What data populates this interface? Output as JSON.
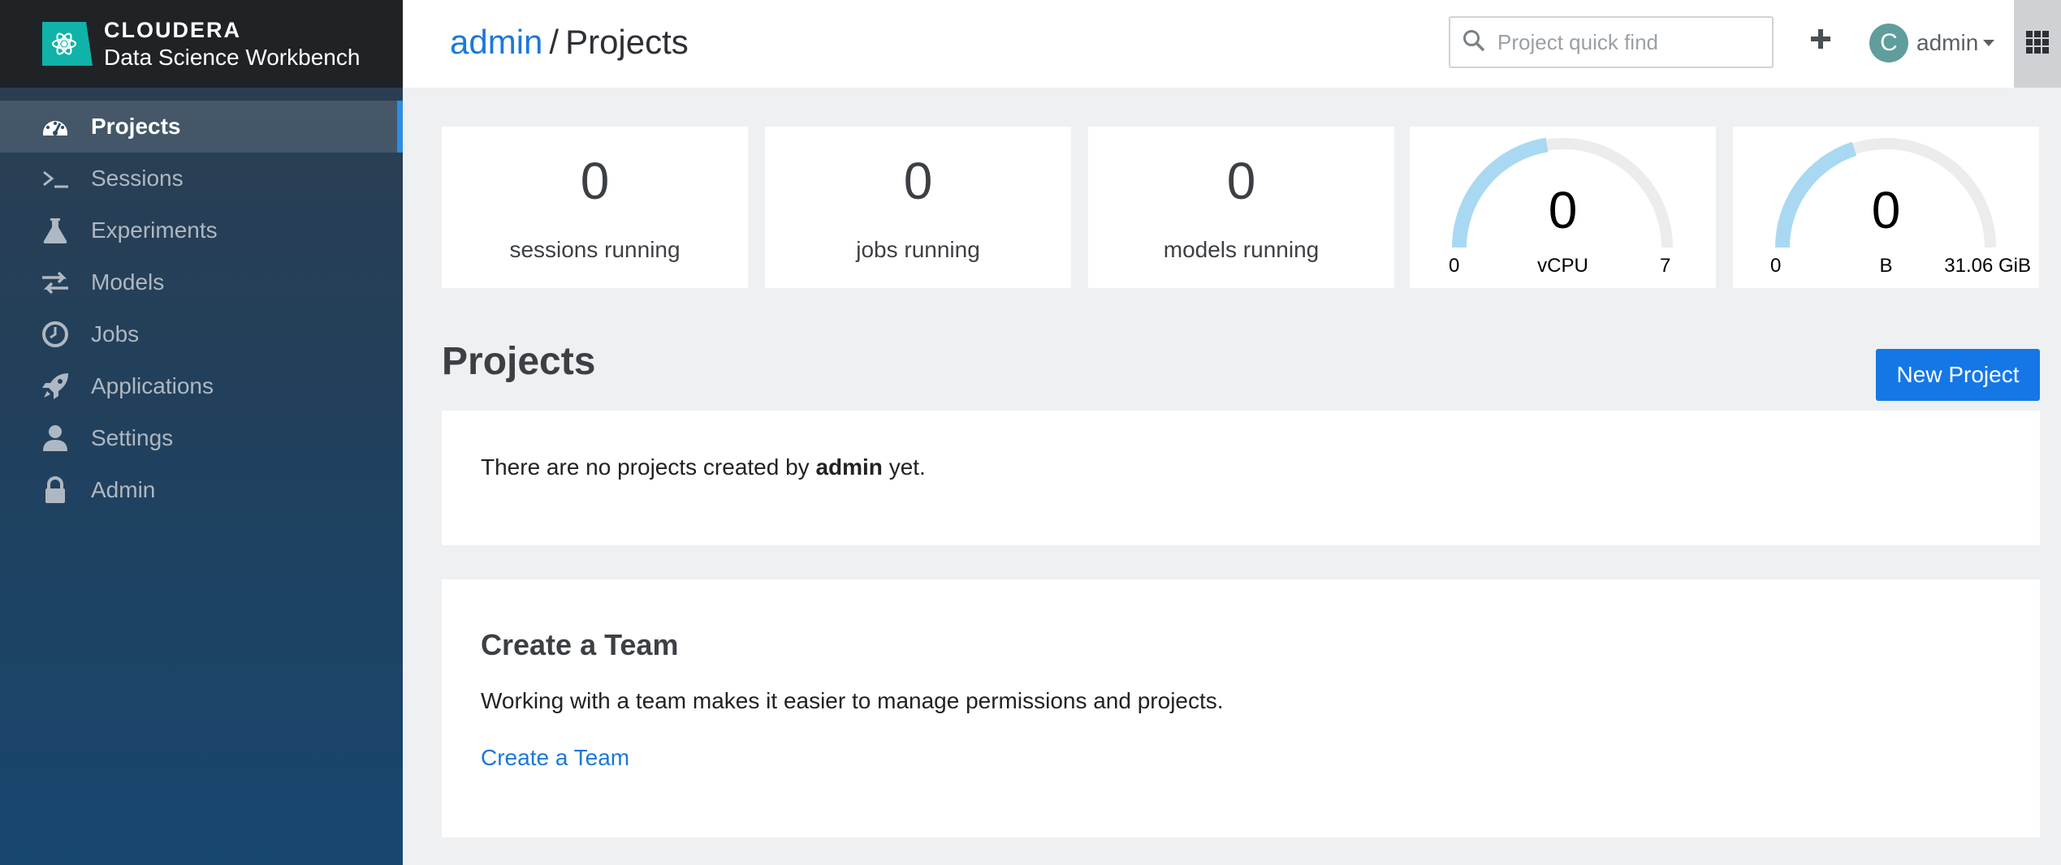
{
  "brand": {
    "name_line1": "CLOUDERA",
    "name_line2": "Data Science Workbench"
  },
  "sidebar": {
    "items": [
      {
        "label": "Projects",
        "icon": "dashboard-icon",
        "active": true
      },
      {
        "label": "Sessions",
        "icon": "terminal-icon",
        "active": false
      },
      {
        "label": "Experiments",
        "icon": "flask-icon",
        "active": false
      },
      {
        "label": "Models",
        "icon": "exchange-arrows-icon",
        "active": false
      },
      {
        "label": "Jobs",
        "icon": "clock-icon",
        "active": false
      },
      {
        "label": "Applications",
        "icon": "rocket-icon",
        "active": false
      },
      {
        "label": "Settings",
        "icon": "user-icon",
        "active": false
      },
      {
        "label": "Admin",
        "icon": "lock-icon",
        "active": false
      }
    ]
  },
  "header": {
    "breadcrumb_user": "admin",
    "breadcrumb_sep": "/",
    "breadcrumb_page": "Projects",
    "search_placeholder": "Project quick find",
    "user_initial": "C",
    "user_name": "admin"
  },
  "stats": {
    "sessions": {
      "value": "0",
      "label": "sessions running"
    },
    "jobs": {
      "value": "0",
      "label": "jobs running"
    },
    "models": {
      "value": "0",
      "label": "models running"
    }
  },
  "gauges": {
    "cpu": {
      "value": "0",
      "unit": "vCPU",
      "min": "0",
      "max": "7",
      "fill_fraction": 0.45
    },
    "memory": {
      "value": "0",
      "unit": "B",
      "min": "0",
      "max": "31.06 GiB",
      "fill_fraction": 0.4
    }
  },
  "projects": {
    "title": "Projects",
    "new_button": "New Project",
    "empty_prefix": "There are no projects created by ",
    "empty_user": "admin",
    "empty_suffix": " yet."
  },
  "team": {
    "title": "Create a Team",
    "description": "Working with a team makes it easier to manage permissions and projects.",
    "link": "Create a Team"
  },
  "colors": {
    "accent": "#1577e6",
    "link": "#1b78d8",
    "gauge_fill": "#a9d9f2",
    "gauge_track": "#ececec",
    "brand": "#0fb3a8"
  }
}
